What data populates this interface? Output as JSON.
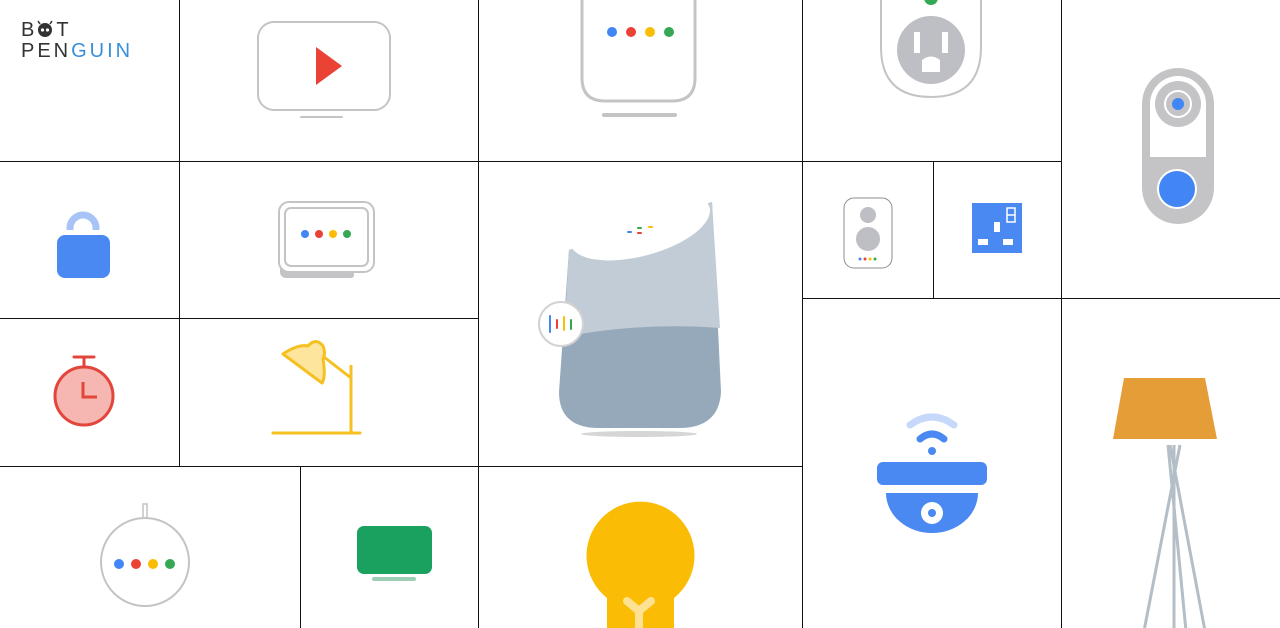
{
  "brand": {
    "line1": "B●T",
    "line2_prefix": "PEN",
    "line2_suffix": "GUIN",
    "accent_color": "#3a8fd9"
  },
  "tiles": [
    {
      "id": "logo",
      "label": "BotPenguin logo"
    },
    {
      "id": "youtube-tv",
      "icon": "play-icon"
    },
    {
      "id": "smart-display",
      "icon": "google-dots"
    },
    {
      "id": "smart-plug-us",
      "icon": "outlet-icon"
    },
    {
      "id": "video-doorbell",
      "icon": "doorbell-icon"
    },
    {
      "id": "smart-lock",
      "icon": "lock-icon"
    },
    {
      "id": "nest-hub",
      "icon": "google-dots"
    },
    {
      "id": "google-home",
      "icon": "assistant-bars-icon"
    },
    {
      "id": "speaker",
      "icon": "speaker-icon"
    },
    {
      "id": "smart-plug-uk",
      "icon": "uk-socket-icon"
    },
    {
      "id": "timer",
      "icon": "stopwatch-icon"
    },
    {
      "id": "desk-lamp",
      "icon": "desk-lamp-icon"
    },
    {
      "id": "security-camera",
      "icon": "wifi-camera-icon"
    },
    {
      "id": "floor-lamp",
      "icon": "floor-lamp-icon"
    },
    {
      "id": "home-mini",
      "icon": "google-dots"
    },
    {
      "id": "tv",
      "icon": "tv-icon"
    },
    {
      "id": "light-bulb",
      "icon": "bulb-icon"
    }
  ],
  "colors": {
    "google_blue": "#4285f4",
    "google_red": "#ea4335",
    "google_yellow": "#fbbc05",
    "google_green": "#34a853",
    "device_gray": "#c4c4c6",
    "grid_line": "#111111"
  }
}
